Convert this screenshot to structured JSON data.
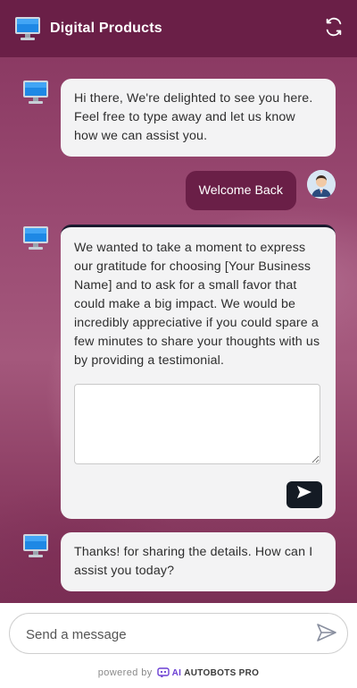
{
  "header": {
    "title": "Digital Products",
    "logo_icon": "monitor-icon",
    "refresh_icon": "refresh-icon",
    "background_color": "#6a1f47"
  },
  "messages": [
    {
      "sender": "bot",
      "text": "Hi there, We're delighted to see you here. Feel free to type away and let us know how we can assist you."
    },
    {
      "sender": "user",
      "text": "Welcome Back"
    },
    {
      "sender": "bot",
      "text": "We wanted to take a moment to express our gratitude for choosing [Your Business Name] and to ask for a small favor that could make a big impact. We would be incredibly appreciative if you could spare a few minutes to share your thoughts with us by providing a testimonial.",
      "form": {
        "textarea_value": "",
        "submit_icon": "send-icon"
      }
    },
    {
      "sender": "bot",
      "text": "Thanks! for sharing the details. How can I assist you today?"
    }
  ],
  "composer": {
    "placeholder": "Send a message",
    "send_icon": "send-icon"
  },
  "footer": {
    "powered_by": "powered by",
    "brand_ai": "AI",
    "brand_name": "AUTOBOTS PRO"
  },
  "colors": {
    "accent": "#6a1f47",
    "bubble_bg": "#f3f3f4",
    "submit_button": "#141b24"
  }
}
